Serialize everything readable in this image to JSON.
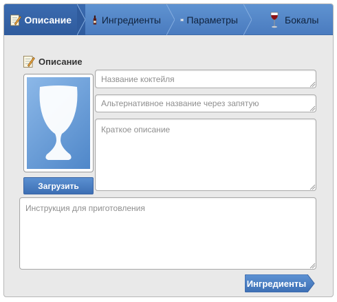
{
  "tabs": [
    {
      "label": "Описание",
      "icon": "notepad-pencil-icon",
      "active": true
    },
    {
      "label": "Ингредиенты",
      "icon": "wine-bottle-icon",
      "active": false
    },
    {
      "label": "Параметры",
      "icon": "plate-cutlery-icon",
      "active": false
    },
    {
      "label": "Бокалы",
      "icon": "wine-glass-icon",
      "active": false
    }
  ],
  "section": {
    "title": "Описание",
    "icon": "notepad-pencil-icon"
  },
  "photo": {
    "icon": "glass-silhouette-icon"
  },
  "upload_label": "Загрузить",
  "fields": {
    "name_placeholder": "Название коктейля",
    "alt_name_placeholder": "Альтернативное название через запятую",
    "short_desc_placeholder": "Краткое описание",
    "instructions_placeholder": "Инструкция для приготовления"
  },
  "next_button": "Ингредиенты",
  "colors": {
    "accent": "#4a7bbf",
    "active_tab": "#2f5b9d",
    "panel_bg": "#e9e9e9"
  }
}
